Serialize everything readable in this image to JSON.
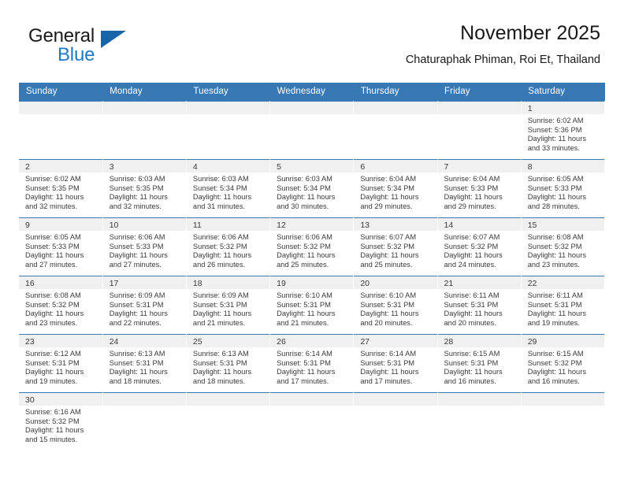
{
  "brand": {
    "name_part1": "General",
    "name_part2": "Blue",
    "accent_color": "#2079c7",
    "triangle_color": "#1565a8"
  },
  "header": {
    "title": "November 2025",
    "subtitle": "Chaturaphak Phiman, Roi Et, Thailand"
  },
  "theme": {
    "header_blue": "#3878b5",
    "daynum_band": "#f0f0f0",
    "text": "#3a3a3a"
  },
  "weekday_headers": [
    "Sunday",
    "Monday",
    "Tuesday",
    "Wednesday",
    "Thursday",
    "Friday",
    "Saturday"
  ],
  "labels": {
    "sunrise_prefix": "Sunrise: ",
    "sunset_prefix": "Sunset: ",
    "daylight_prefix": "Daylight: "
  },
  "weeks": [
    [
      {
        "day": "",
        "sunrise": "",
        "sunset": "",
        "daylight_line1": "",
        "daylight_line2": ""
      },
      {
        "day": "",
        "sunrise": "",
        "sunset": "",
        "daylight_line1": "",
        "daylight_line2": ""
      },
      {
        "day": "",
        "sunrise": "",
        "sunset": "",
        "daylight_line1": "",
        "daylight_line2": ""
      },
      {
        "day": "",
        "sunrise": "",
        "sunset": "",
        "daylight_line1": "",
        "daylight_line2": ""
      },
      {
        "day": "",
        "sunrise": "",
        "sunset": "",
        "daylight_line1": "",
        "daylight_line2": ""
      },
      {
        "day": "",
        "sunrise": "",
        "sunset": "",
        "daylight_line1": "",
        "daylight_line2": ""
      },
      {
        "day": "1",
        "sunrise": "Sunrise: 6:02 AM",
        "sunset": "Sunset: 5:36 PM",
        "daylight_line1": "Daylight: 11 hours",
        "daylight_line2": "and 33 minutes."
      }
    ],
    [
      {
        "day": "2",
        "sunrise": "Sunrise: 6:02 AM",
        "sunset": "Sunset: 5:35 PM",
        "daylight_line1": "Daylight: 11 hours",
        "daylight_line2": "and 32 minutes."
      },
      {
        "day": "3",
        "sunrise": "Sunrise: 6:03 AM",
        "sunset": "Sunset: 5:35 PM",
        "daylight_line1": "Daylight: 11 hours",
        "daylight_line2": "and 32 minutes."
      },
      {
        "day": "4",
        "sunrise": "Sunrise: 6:03 AM",
        "sunset": "Sunset: 5:34 PM",
        "daylight_line1": "Daylight: 11 hours",
        "daylight_line2": "and 31 minutes."
      },
      {
        "day": "5",
        "sunrise": "Sunrise: 6:03 AM",
        "sunset": "Sunset: 5:34 PM",
        "daylight_line1": "Daylight: 11 hours",
        "daylight_line2": "and 30 minutes."
      },
      {
        "day": "6",
        "sunrise": "Sunrise: 6:04 AM",
        "sunset": "Sunset: 5:34 PM",
        "daylight_line1": "Daylight: 11 hours",
        "daylight_line2": "and 29 minutes."
      },
      {
        "day": "7",
        "sunrise": "Sunrise: 6:04 AM",
        "sunset": "Sunset: 5:33 PM",
        "daylight_line1": "Daylight: 11 hours",
        "daylight_line2": "and 29 minutes."
      },
      {
        "day": "8",
        "sunrise": "Sunrise: 6:05 AM",
        "sunset": "Sunset: 5:33 PM",
        "daylight_line1": "Daylight: 11 hours",
        "daylight_line2": "and 28 minutes."
      }
    ],
    [
      {
        "day": "9",
        "sunrise": "Sunrise: 6:05 AM",
        "sunset": "Sunset: 5:33 PM",
        "daylight_line1": "Daylight: 11 hours",
        "daylight_line2": "and 27 minutes."
      },
      {
        "day": "10",
        "sunrise": "Sunrise: 6:06 AM",
        "sunset": "Sunset: 5:33 PM",
        "daylight_line1": "Daylight: 11 hours",
        "daylight_line2": "and 27 minutes."
      },
      {
        "day": "11",
        "sunrise": "Sunrise: 6:06 AM",
        "sunset": "Sunset: 5:32 PM",
        "daylight_line1": "Daylight: 11 hours",
        "daylight_line2": "and 26 minutes."
      },
      {
        "day": "12",
        "sunrise": "Sunrise: 6:06 AM",
        "sunset": "Sunset: 5:32 PM",
        "daylight_line1": "Daylight: 11 hours",
        "daylight_line2": "and 25 minutes."
      },
      {
        "day": "13",
        "sunrise": "Sunrise: 6:07 AM",
        "sunset": "Sunset: 5:32 PM",
        "daylight_line1": "Daylight: 11 hours",
        "daylight_line2": "and 25 minutes."
      },
      {
        "day": "14",
        "sunrise": "Sunrise: 6:07 AM",
        "sunset": "Sunset: 5:32 PM",
        "daylight_line1": "Daylight: 11 hours",
        "daylight_line2": "and 24 minutes."
      },
      {
        "day": "15",
        "sunrise": "Sunrise: 6:08 AM",
        "sunset": "Sunset: 5:32 PM",
        "daylight_line1": "Daylight: 11 hours",
        "daylight_line2": "and 23 minutes."
      }
    ],
    [
      {
        "day": "16",
        "sunrise": "Sunrise: 6:08 AM",
        "sunset": "Sunset: 5:32 PM",
        "daylight_line1": "Daylight: 11 hours",
        "daylight_line2": "and 23 minutes."
      },
      {
        "day": "17",
        "sunrise": "Sunrise: 6:09 AM",
        "sunset": "Sunset: 5:31 PM",
        "daylight_line1": "Daylight: 11 hours",
        "daylight_line2": "and 22 minutes."
      },
      {
        "day": "18",
        "sunrise": "Sunrise: 6:09 AM",
        "sunset": "Sunset: 5:31 PM",
        "daylight_line1": "Daylight: 11 hours",
        "daylight_line2": "and 21 minutes."
      },
      {
        "day": "19",
        "sunrise": "Sunrise: 6:10 AM",
        "sunset": "Sunset: 5:31 PM",
        "daylight_line1": "Daylight: 11 hours",
        "daylight_line2": "and 21 minutes."
      },
      {
        "day": "20",
        "sunrise": "Sunrise: 6:10 AM",
        "sunset": "Sunset: 5:31 PM",
        "daylight_line1": "Daylight: 11 hours",
        "daylight_line2": "and 20 minutes."
      },
      {
        "day": "21",
        "sunrise": "Sunrise: 6:11 AM",
        "sunset": "Sunset: 5:31 PM",
        "daylight_line1": "Daylight: 11 hours",
        "daylight_line2": "and 20 minutes."
      },
      {
        "day": "22",
        "sunrise": "Sunrise: 6:11 AM",
        "sunset": "Sunset: 5:31 PM",
        "daylight_line1": "Daylight: 11 hours",
        "daylight_line2": "and 19 minutes."
      }
    ],
    [
      {
        "day": "23",
        "sunrise": "Sunrise: 6:12 AM",
        "sunset": "Sunset: 5:31 PM",
        "daylight_line1": "Daylight: 11 hours",
        "daylight_line2": "and 19 minutes."
      },
      {
        "day": "24",
        "sunrise": "Sunrise: 6:13 AM",
        "sunset": "Sunset: 5:31 PM",
        "daylight_line1": "Daylight: 11 hours",
        "daylight_line2": "and 18 minutes."
      },
      {
        "day": "25",
        "sunrise": "Sunrise: 6:13 AM",
        "sunset": "Sunset: 5:31 PM",
        "daylight_line1": "Daylight: 11 hours",
        "daylight_line2": "and 18 minutes."
      },
      {
        "day": "26",
        "sunrise": "Sunrise: 6:14 AM",
        "sunset": "Sunset: 5:31 PM",
        "daylight_line1": "Daylight: 11 hours",
        "daylight_line2": "and 17 minutes."
      },
      {
        "day": "27",
        "sunrise": "Sunrise: 6:14 AM",
        "sunset": "Sunset: 5:31 PM",
        "daylight_line1": "Daylight: 11 hours",
        "daylight_line2": "and 17 minutes."
      },
      {
        "day": "28",
        "sunrise": "Sunrise: 6:15 AM",
        "sunset": "Sunset: 5:31 PM",
        "daylight_line1": "Daylight: 11 hours",
        "daylight_line2": "and 16 minutes."
      },
      {
        "day": "29",
        "sunrise": "Sunrise: 6:15 AM",
        "sunset": "Sunset: 5:32 PM",
        "daylight_line1": "Daylight: 11 hours",
        "daylight_line2": "and 16 minutes."
      }
    ],
    [
      {
        "day": "30",
        "sunrise": "Sunrise: 6:16 AM",
        "sunset": "Sunset: 5:32 PM",
        "daylight_line1": "Daylight: 11 hours",
        "daylight_line2": "and 15 minutes."
      },
      {
        "day": "",
        "sunrise": "",
        "sunset": "",
        "daylight_line1": "",
        "daylight_line2": ""
      },
      {
        "day": "",
        "sunrise": "",
        "sunset": "",
        "daylight_line1": "",
        "daylight_line2": ""
      },
      {
        "day": "",
        "sunrise": "",
        "sunset": "",
        "daylight_line1": "",
        "daylight_line2": ""
      },
      {
        "day": "",
        "sunrise": "",
        "sunset": "",
        "daylight_line1": "",
        "daylight_line2": ""
      },
      {
        "day": "",
        "sunrise": "",
        "sunset": "",
        "daylight_line1": "",
        "daylight_line2": ""
      },
      {
        "day": "",
        "sunrise": "",
        "sunset": "",
        "daylight_line1": "",
        "daylight_line2": ""
      }
    ]
  ]
}
